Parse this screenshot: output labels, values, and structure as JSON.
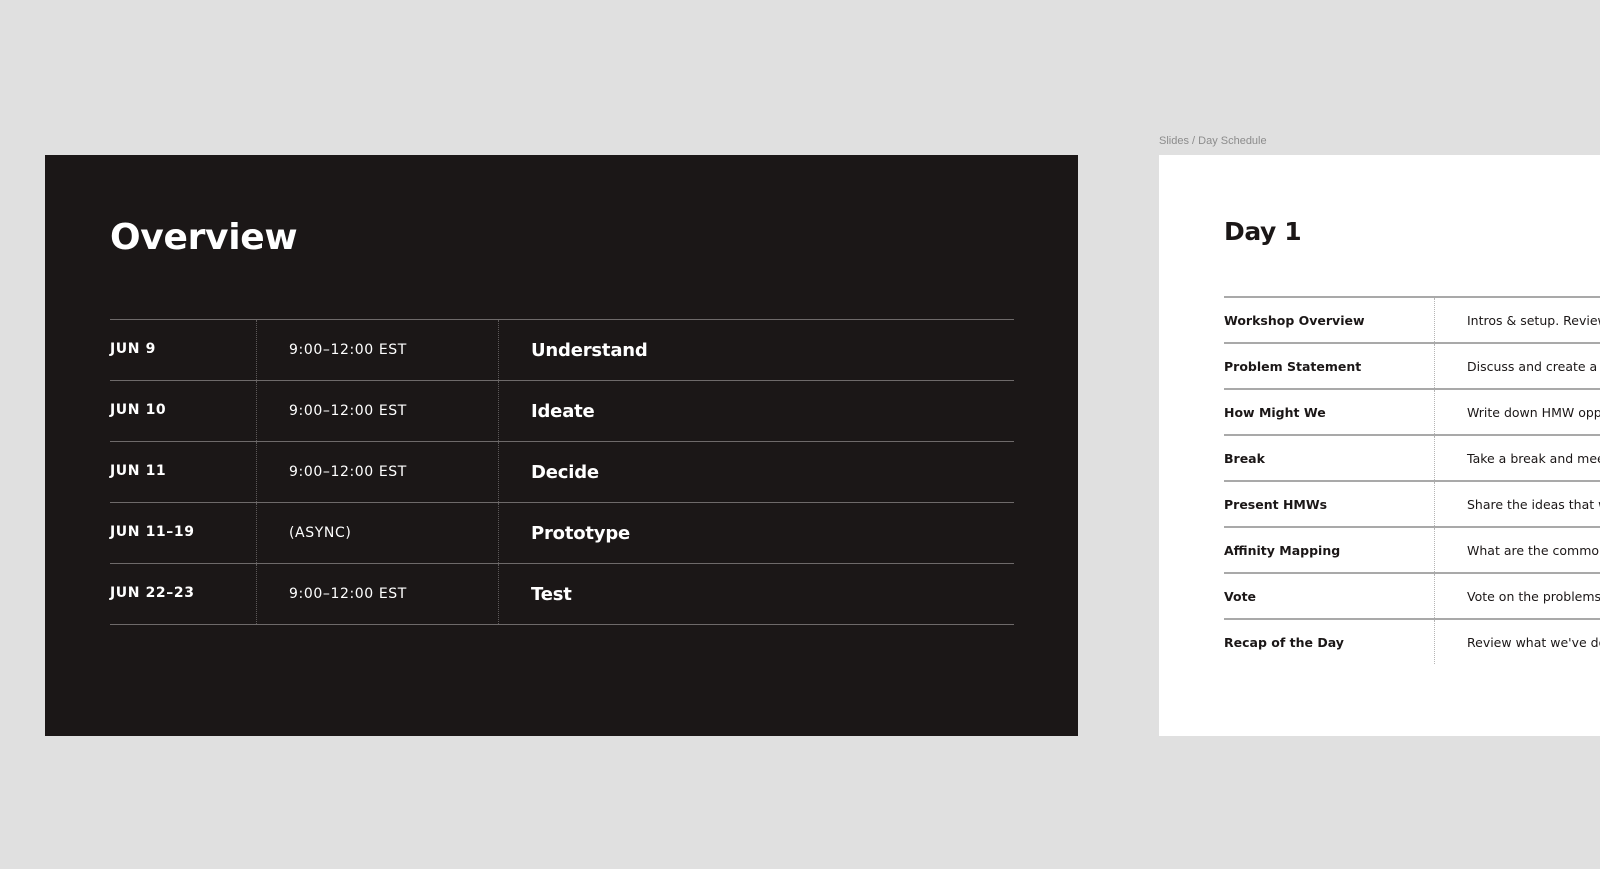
{
  "overview": {
    "title": "Overview",
    "rows": [
      {
        "date": "JUN 9",
        "time": "9:00–12:00 EST",
        "phase": "Understand"
      },
      {
        "date": "JUN 10",
        "time": "9:00–12:00 EST",
        "phase": "Ideate"
      },
      {
        "date": "JUN 11",
        "time": "9:00–12:00 EST",
        "phase": "Decide"
      },
      {
        "date": "JUN 11–19",
        "time": "(ASYNC)",
        "phase": "Prototype"
      },
      {
        "date": "JUN 22–23",
        "time": "9:00–12:00 EST",
        "phase": "Test"
      }
    ]
  },
  "day_schedule": {
    "frame_label": "Slides / Day Schedule",
    "title": "Day 1",
    "rows": [
      {
        "activity": "Workshop Overview",
        "description": "Intros & setup. Review c"
      },
      {
        "activity": "Problem Statement",
        "description": "Discuss and create a pr"
      },
      {
        "activity": "How Might We",
        "description": "Write down HMW oppo"
      },
      {
        "activity": "Break",
        "description": "Take a break and meet l"
      },
      {
        "activity": "Present HMWs",
        "description": "Share the ideas that we"
      },
      {
        "activity": "Affinity Mapping",
        "description": "What are the common t"
      },
      {
        "activity": "Vote",
        "description": "Vote on the problems in"
      },
      {
        "activity": "Recap of the Day",
        "description": "Review what we've don"
      }
    ]
  },
  "colors": {
    "canvas": "#e0e0e0",
    "dark_slide": "#1b1717",
    "light_slide": "#ffffff",
    "caption": "#8c8c8c"
  }
}
